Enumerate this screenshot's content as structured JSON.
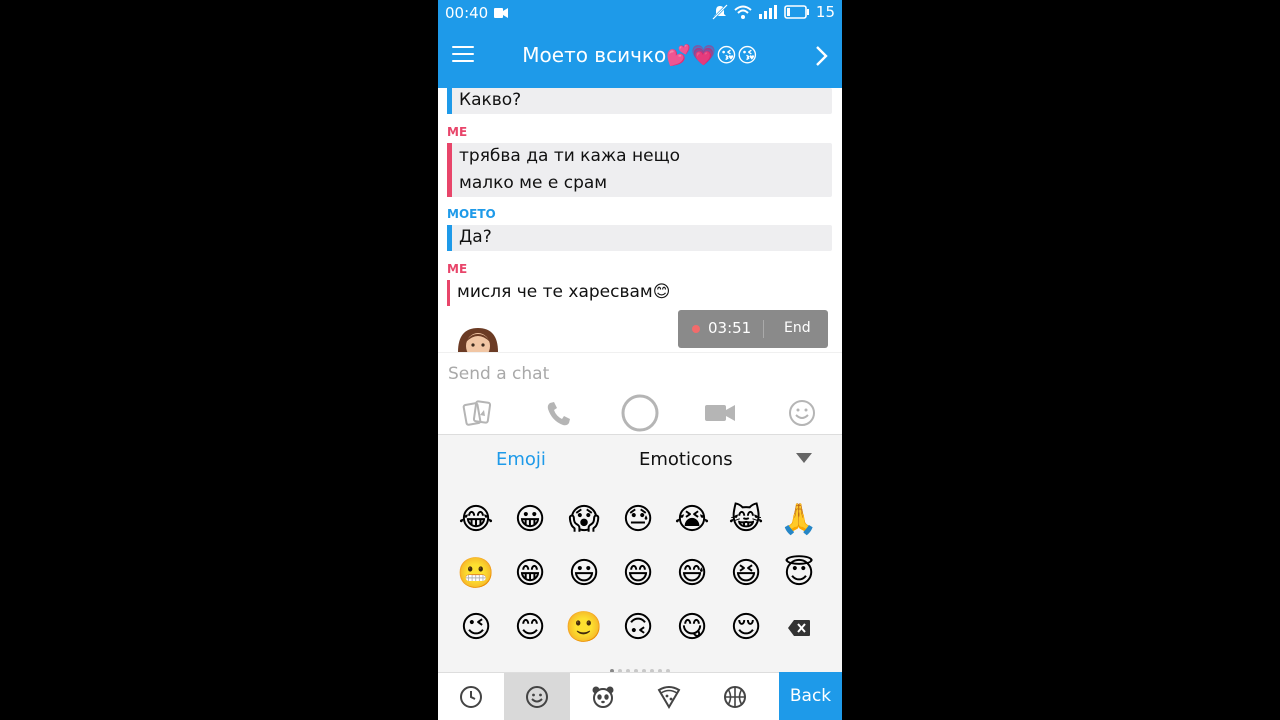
{
  "status_bar": {
    "time": "00:40",
    "battery_text": "15",
    "icons": [
      "video-record-icon",
      "mute-icon",
      "wifi-icon",
      "signal-icon",
      "battery-icon"
    ]
  },
  "header": {
    "title": "Моето всичко💕💗😘😘",
    "left_icon": "menu-icon",
    "right_icon": "chevron-right-icon"
  },
  "chat": {
    "messages": [
      {
        "sender": "",
        "color": "#1e9ae9",
        "lines": [
          "Какво?"
        ]
      },
      {
        "sender": "ME",
        "color": "#e8456a",
        "lines": [
          "трябва да ти кажа нещо",
          "малко ме е срам"
        ]
      },
      {
        "sender": "МОЕТО",
        "color": "#1e9ae9",
        "lines": [
          "Да?"
        ]
      },
      {
        "sender": "ME",
        "color": "#e8456a",
        "lines": [
          "мисля че те харесвам😊"
        ]
      }
    ]
  },
  "recording": {
    "timer": "03:51",
    "end_label": "End"
  },
  "input": {
    "placeholder": "Send a chat"
  },
  "actions": [
    "cards-icon",
    "phone-icon",
    "capture-circle-icon",
    "video-camera-icon",
    "smiley-icon"
  ],
  "emoji_panel": {
    "tab_emoji": "Emoji",
    "tab_emoticons": "Emoticons",
    "rows": [
      [
        "😂",
        "😀",
        "😱",
        "😓",
        "😭",
        "😹",
        "🙏"
      ],
      [
        "😬",
        "😁",
        "😃",
        "😄",
        "😅",
        "😆",
        "😇"
      ],
      [
        "😉",
        "😊",
        "🙂",
        "🙃",
        "😋",
        "😌"
      ]
    ],
    "page_count": 8,
    "current_page": 1
  },
  "category_bar": {
    "items": [
      "recent-clock-icon",
      "smiley-icon",
      "panda-icon",
      "pizza-icon",
      "basketball-icon"
    ],
    "selected": 1,
    "back_label": "Back"
  },
  "colors": {
    "accent": "#1e9ae9",
    "me": "#e8456a",
    "bubble": "#eeeef0"
  }
}
